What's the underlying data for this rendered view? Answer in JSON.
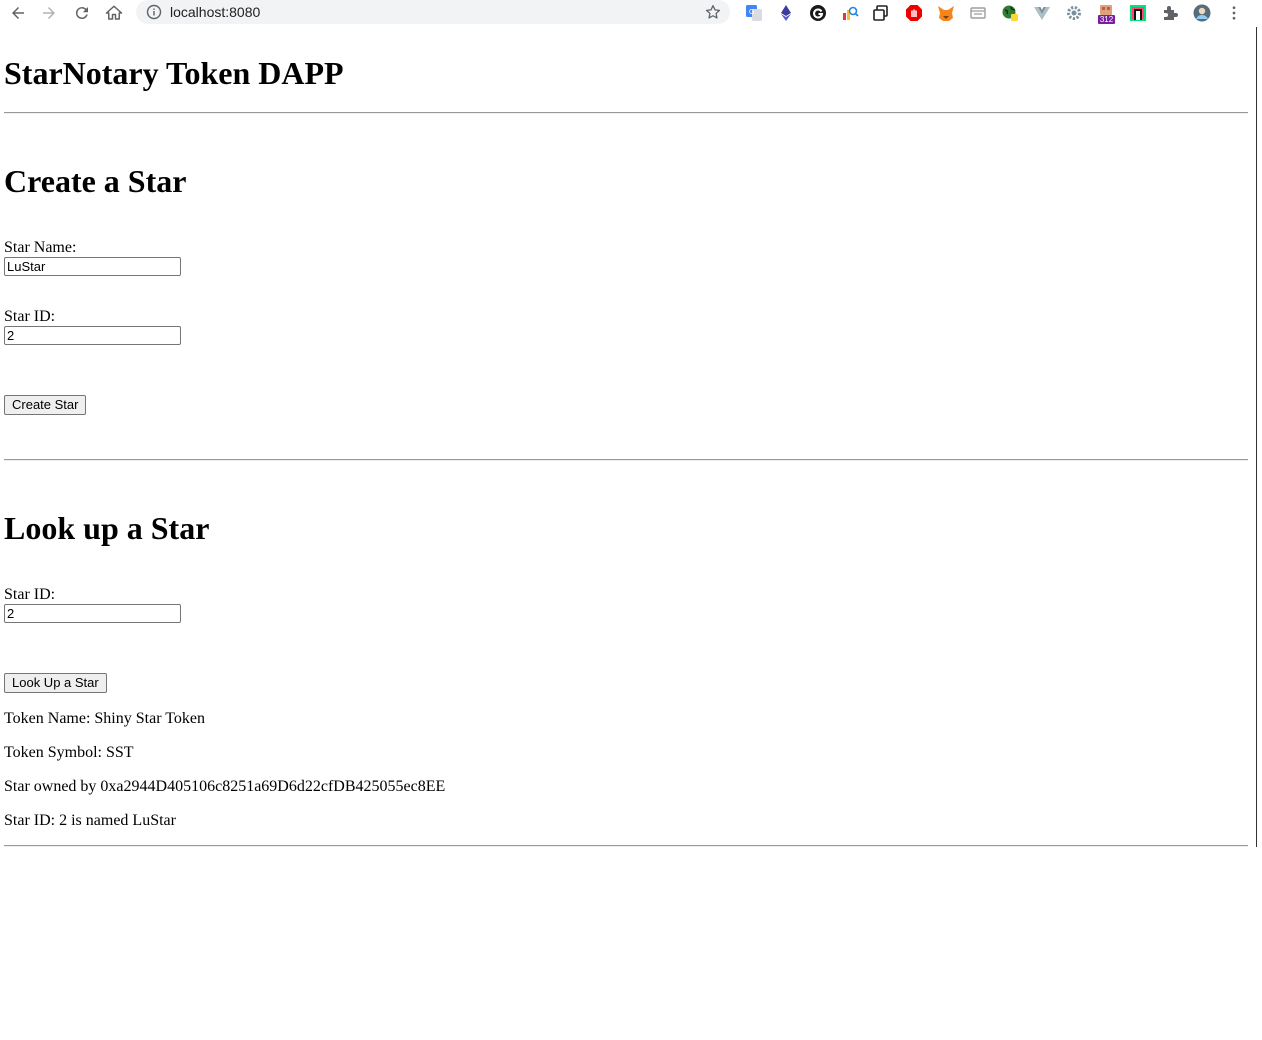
{
  "browser": {
    "url": "localhost:8080",
    "extension_badge": "312",
    "extensions": [
      "google-translate-icon",
      "ethereum-icon",
      "grammarly-icon",
      "search-tool-icon",
      "tab-copy-icon",
      "adblock-icon",
      "metamask-icon",
      "reader-icon",
      "earth-icon",
      "vue-devtools-icon",
      "settings-icon",
      "calendar-icon",
      "notion-icon",
      "puzzle-icon",
      "avatar"
    ]
  },
  "page": {
    "title": "StarNotary Token DAPP",
    "create": {
      "heading": "Create a Star",
      "name_label": "Star Name:",
      "name_value": "LuStar",
      "id_label": "Star ID:",
      "id_value": "2",
      "button": "Create Star"
    },
    "lookup": {
      "heading": "Look up a Star",
      "id_label": "Star ID:",
      "id_value": "2",
      "button": "Look Up a Star",
      "token_name": "Token Name: Shiny Star Token",
      "token_symbol": "Token Symbol: SST",
      "owner": "Star owned by 0xa2944D405106c8251a69D6d22cfDB425055ec8EE",
      "star_info": "Star ID: 2 is named LuStar"
    }
  },
  "colors": {
    "toolbar_icon": "#5f6368",
    "omnibox_bg": "#f1f3f4",
    "rule": "#9a9a9a"
  }
}
